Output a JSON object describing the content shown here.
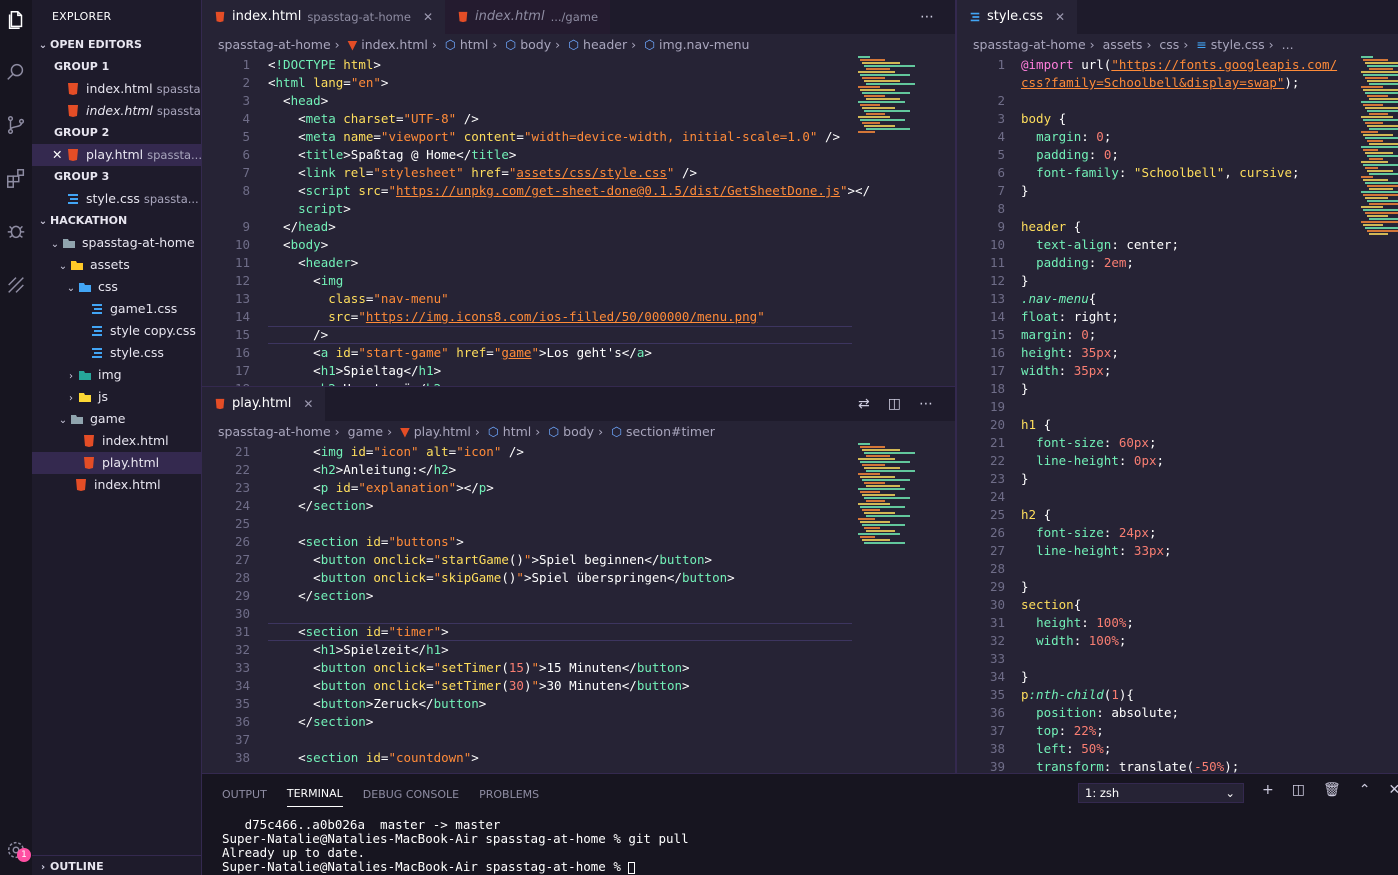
{
  "sidebar": {
    "title": "EXPLORER",
    "open_editors": "OPEN EDITORS",
    "group1": "GROUP 1",
    "group2": "GROUP 2",
    "group3": "GROUP 3",
    "oe_index1": "index.html",
    "oe_index1_desc": "spassta...",
    "oe_index2": "index.html",
    "oe_index2_desc": "spassta...",
    "oe_play": "play.html",
    "oe_play_desc": "spassta...",
    "oe_style": "style.css",
    "oe_style_desc": "spassta...",
    "workspace": "HACKATHON",
    "tree": [
      "spasstag-at-home",
      "assets",
      "css",
      "game1.css",
      "style copy.css",
      "style.css",
      "img",
      "js",
      "game",
      "index.html",
      "play.html",
      "index.html"
    ],
    "outline": "OUTLINE",
    "badge": "1"
  },
  "editor_top": {
    "tab1": "index.html",
    "tab1_desc": "spasstag-at-home",
    "tab2": "index.html",
    "tab2_desc": ".../game",
    "crumbs": [
      "spasstag-at-home",
      "index.html",
      "html",
      "body",
      "header",
      "img.nav-menu"
    ]
  },
  "editor_bottom": {
    "tab": "play.html",
    "crumbs": [
      "spasstag-at-home",
      "game",
      "play.html",
      "html",
      "body",
      "section#timer"
    ]
  },
  "editor_right": {
    "tab": "style.css",
    "crumbs": [
      "spasstag-at-home",
      "assets",
      "css",
      "style.css",
      "..."
    ]
  },
  "panel": {
    "tabs": [
      "OUTPUT",
      "TERMINAL",
      "DEBUG CONSOLE",
      "PROBLEMS"
    ],
    "terminal_select": "1: zsh",
    "terminal_lines": [
      "   d75c466..a0b026a  master -> master",
      "Super-Natalie@Natalies-MacBook-Air spasstag-at-home % git pull",
      "Already up to date.",
      "Super-Natalie@Natalies-MacBook-Air spasstag-at-home % "
    ]
  },
  "colors": {
    "tag": "#72f1b8",
    "attr": "#fede5d",
    "string": "#ff8b39",
    "keyword": "#fede5d",
    "number": "#f97e72",
    "bg": "#262335"
  }
}
